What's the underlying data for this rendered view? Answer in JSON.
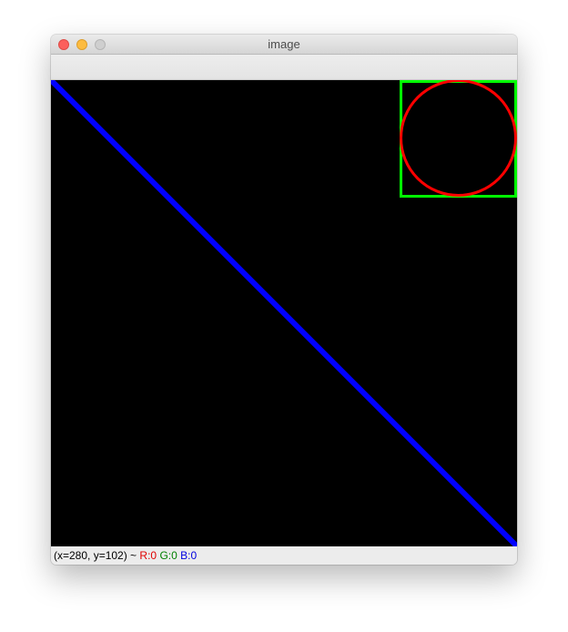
{
  "window": {
    "title": "image"
  },
  "image": {
    "background_color": "#000000",
    "line_color": "#0000ff",
    "rectangle_color": "#00ff00",
    "circle_color": "#ff0000"
  },
  "status": {
    "coords": "(x=280, y=102) ~",
    "r": "R:0",
    "g": "G:0",
    "b": "B:0",
    "r_color": "#e00000",
    "g_color": "#008000",
    "b_color": "#0000e0"
  }
}
